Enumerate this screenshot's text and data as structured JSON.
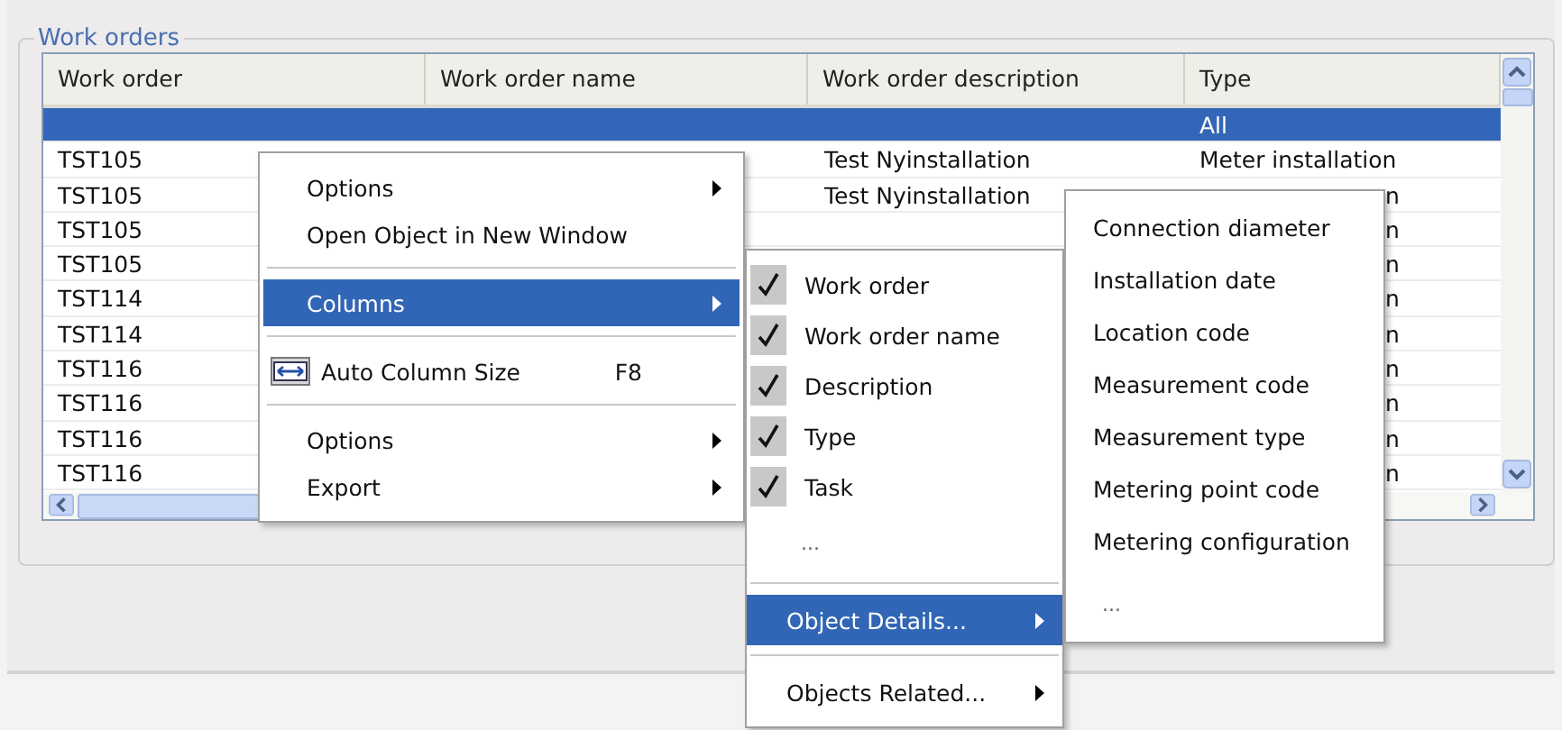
{
  "group_title": "Work orders",
  "table": {
    "columns": [
      "Work order",
      "Work order name",
      "Work order description",
      "Type"
    ],
    "rows": [
      {
        "selected": true,
        "type": "All"
      },
      {
        "selected": false,
        "work_order": "TST105",
        "description": "Test Nyinstallation",
        "type": "Meter installation"
      },
      {
        "selected": false,
        "work_order": "TST105",
        "description": "Test Nyinstallation",
        "type": "n",
        "type_clipped": true
      },
      {
        "selected": false,
        "work_order": "TST105",
        "type": "n",
        "type_clipped": true
      },
      {
        "selected": false,
        "work_order": "TST105",
        "type": "n",
        "type_clipped": true
      },
      {
        "selected": false,
        "work_order": "TST114",
        "type": "n",
        "type_clipped": true
      },
      {
        "selected": false,
        "work_order": "TST114",
        "type": "n",
        "type_clipped": true
      },
      {
        "selected": false,
        "work_order": "TST116",
        "type": "n",
        "type_clipped": true
      },
      {
        "selected": false,
        "work_order": "TST116",
        "type": "n",
        "type_clipped": true
      },
      {
        "selected": false,
        "work_order": "TST116",
        "type": "n",
        "type_clipped": true
      },
      {
        "selected": false,
        "work_order": "TST116",
        "type": "n",
        "type_clipped": true
      }
    ]
  },
  "context_menu": [
    {
      "kind": "item",
      "label": "Options",
      "submenu": true,
      "selected": false
    },
    {
      "kind": "item",
      "label": "Open Object in New Window",
      "submenu": false,
      "selected": false
    },
    {
      "kind": "separator"
    },
    {
      "kind": "item",
      "label": "Columns",
      "submenu": true,
      "selected": true
    },
    {
      "kind": "separator"
    },
    {
      "kind": "icon-item",
      "label": "Auto Column Size",
      "shortcut": "F8",
      "submenu": false,
      "selected": false
    },
    {
      "kind": "separator"
    },
    {
      "kind": "item",
      "label": "Options",
      "submenu": true,
      "selected": false
    },
    {
      "kind": "item",
      "label": "Export",
      "submenu": true,
      "selected": false
    }
  ],
  "columns_menu": [
    {
      "kind": "check",
      "label": "Work order",
      "checked": true
    },
    {
      "kind": "check",
      "label": "Work order name",
      "checked": true
    },
    {
      "kind": "check",
      "label": "Description",
      "checked": true
    },
    {
      "kind": "check",
      "label": "Type",
      "checked": true
    },
    {
      "kind": "check",
      "label": "Task",
      "checked": true
    },
    {
      "kind": "more",
      "label": "..."
    },
    {
      "kind": "separator"
    },
    {
      "kind": "item",
      "label": "Object Details...",
      "submenu": true,
      "selected": true
    },
    {
      "kind": "separator"
    },
    {
      "kind": "item",
      "label": "Objects Related...",
      "submenu": true,
      "selected": false
    }
  ],
  "details_menu": [
    {
      "kind": "item",
      "label": "Connection diameter"
    },
    {
      "kind": "item",
      "label": "Installation date"
    },
    {
      "kind": "item",
      "label": "Location code"
    },
    {
      "kind": "item",
      "label": "Measurement code"
    },
    {
      "kind": "item",
      "label": "Measurement type"
    },
    {
      "kind": "item",
      "label": "Metering point code"
    },
    {
      "kind": "item",
      "label": "Metering configuration"
    },
    {
      "kind": "more",
      "label": "..."
    }
  ]
}
